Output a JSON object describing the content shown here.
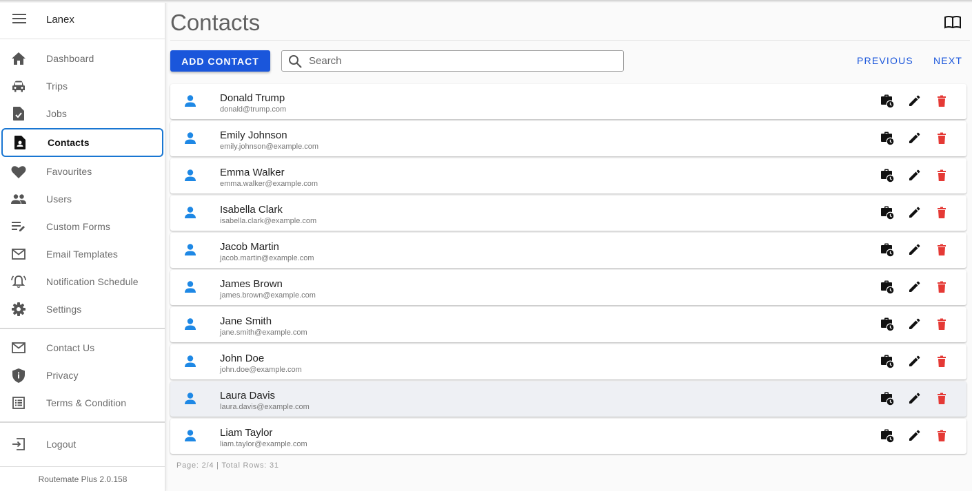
{
  "sidebar": {
    "app_name": "Lanex",
    "nav": [
      {
        "label": "Dashboard",
        "icon": "home-icon"
      },
      {
        "label": "Trips",
        "icon": "car-icon"
      },
      {
        "label": "Jobs",
        "icon": "task-icon"
      },
      {
        "label": "Contacts",
        "icon": "contact-card-icon",
        "active": true
      },
      {
        "label": "Favourites",
        "icon": "heart-icon"
      },
      {
        "label": "Users",
        "icon": "group-icon"
      },
      {
        "label": "Custom Forms",
        "icon": "edit-list-icon"
      },
      {
        "label": "Email Templates",
        "icon": "mail-icon"
      },
      {
        "label": "Notification Schedule",
        "icon": "bell-icon"
      },
      {
        "label": "Settings",
        "icon": "gear-icon"
      }
    ],
    "secondary": [
      {
        "label": "Contact Us",
        "icon": "mail-icon"
      },
      {
        "label": "Privacy",
        "icon": "shield-icon"
      },
      {
        "label": "Terms & Condition",
        "icon": "list-icon"
      }
    ],
    "logout": {
      "label": "Logout",
      "icon": "logout-icon"
    },
    "version": "Routemate Plus 2.0.158"
  },
  "main": {
    "title": "Contacts",
    "add_button": "ADD CONTACT",
    "search_placeholder": "Search",
    "search_value": "",
    "previous": "PREVIOUS",
    "next": "NEXT",
    "contacts": [
      {
        "name": "Donald Trump",
        "email": "donald@trump.com"
      },
      {
        "name": "Emily Johnson",
        "email": "emily.johnson@example.com"
      },
      {
        "name": "Emma Walker",
        "email": "emma.walker@example.com"
      },
      {
        "name": "Isabella Clark",
        "email": "isabella.clark@example.com"
      },
      {
        "name": "Jacob Martin",
        "email": "jacob.martin@example.com"
      },
      {
        "name": "James Brown",
        "email": "james.brown@example.com"
      },
      {
        "name": "Jane Smith",
        "email": "jane.smith@example.com"
      },
      {
        "name": "John Doe",
        "email": "john.doe@example.com"
      },
      {
        "name": "Laura Davis",
        "email": "laura.davis@example.com",
        "hovered": true
      },
      {
        "name": "Liam Taylor",
        "email": "liam.taylor@example.com"
      }
    ],
    "page_info": "Page: 2/4 | Total Rows: 31"
  },
  "colors": {
    "accent": "#1a56db",
    "active_border": "#1976d2",
    "person_icon": "#1e88e5",
    "delete_icon": "#e53935"
  }
}
